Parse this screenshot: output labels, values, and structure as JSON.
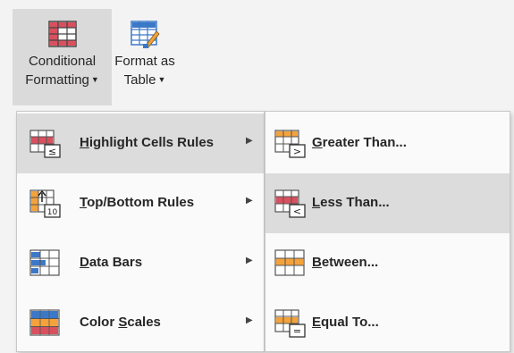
{
  "ribbon": {
    "conditional_formatting": {
      "line1": "Conditional",
      "line2": "Formatting"
    },
    "format_as_table": {
      "line1": "Format as",
      "line2": "Table"
    }
  },
  "main_menu": {
    "items": [
      {
        "key": "H",
        "rest": "ighlight Cells Rules",
        "icon": "highlight-cells-rules-icon",
        "highlighted": true
      },
      {
        "key": "T",
        "rest": "op/Bottom Rules",
        "icon": "top-bottom-rules-icon",
        "highlighted": false
      },
      {
        "key": "D",
        "rest": "ata Bars",
        "icon": "data-bars-icon",
        "highlighted": false
      },
      {
        "pre": "Color ",
        "key": "S",
        "rest": "cales",
        "icon": "color-scales-icon",
        "highlighted": false
      }
    ]
  },
  "submenu": {
    "items": [
      {
        "key": "G",
        "rest": "reater Than...",
        "icon": "greater-than-icon",
        "highlighted": false
      },
      {
        "key": "L",
        "rest": "ess Than...",
        "icon": "less-than-icon",
        "highlighted": true
      },
      {
        "key": "B",
        "rest": "etween...",
        "icon": "between-icon",
        "highlighted": false
      },
      {
        "key": "E",
        "rest": "qual To...",
        "icon": "equal-to-icon",
        "highlighted": false
      }
    ]
  },
  "colors": {
    "accent_red": "#d9505e",
    "accent_orange": "#f3a23c",
    "accent_blue": "#3c78c8",
    "menu_highlight": "#dcdcdc"
  }
}
